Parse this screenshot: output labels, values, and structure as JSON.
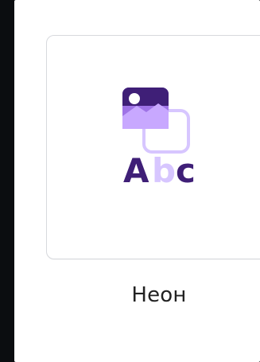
{
  "item": {
    "label": "Неон",
    "icon_name": "image-text-style-icon",
    "preview_text": {
      "a": "A",
      "b": "b",
      "c": "c"
    }
  },
  "colors": {
    "background": "#0b0d10",
    "panel": "#ffffff",
    "tile_border": "#d7d9dd",
    "accent_dark": "#3f1f77",
    "accent_mid": "#9f73e6",
    "accent_light": "#d7c6ff",
    "text": "#222222"
  }
}
